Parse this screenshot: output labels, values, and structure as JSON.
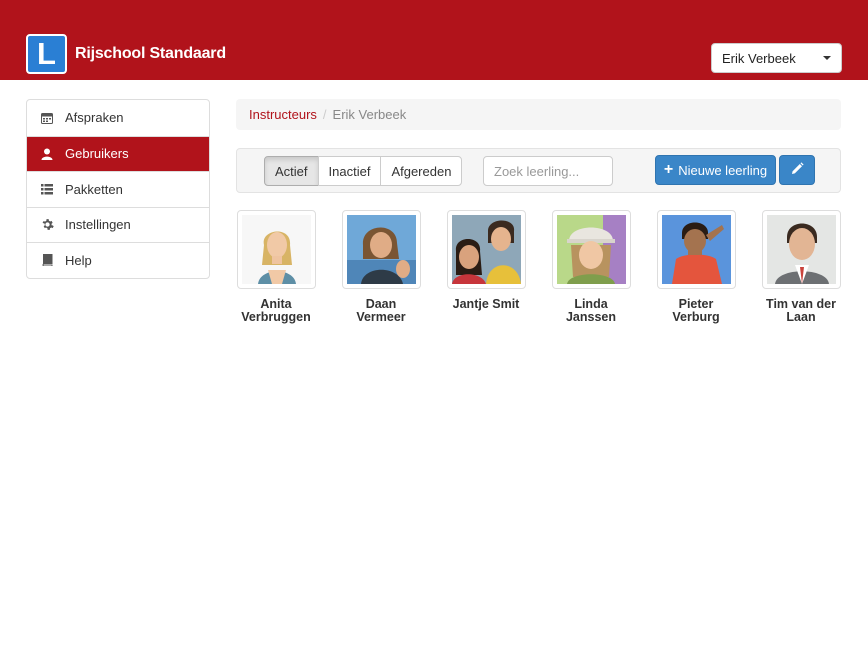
{
  "header": {
    "logo_letter": "L",
    "brand": "Rijschool Standaard",
    "user": "Erik Verbeek"
  },
  "sidebar": {
    "items": [
      {
        "label": "Afspraken",
        "icon": "calendar-icon"
      },
      {
        "label": "Gebruikers",
        "icon": "user-icon",
        "active": true
      },
      {
        "label": "Pakketten",
        "icon": "list-icon"
      },
      {
        "label": "Instellingen",
        "icon": "gear-icon"
      },
      {
        "label": "Help",
        "icon": "book-icon"
      }
    ]
  },
  "breadcrumb": {
    "link": "Instructeurs",
    "separator": "/",
    "current": "Erik Verbeek"
  },
  "toolbar": {
    "filters": [
      "Actief",
      "Inactief",
      "Afgereden"
    ],
    "active_filter": "Actief",
    "search_placeholder": "Zoek leerling...",
    "new_button": "Nieuwe leerling"
  },
  "students": [
    {
      "name": "Anita Verbruggen"
    },
    {
      "name": "Daan Vermeer"
    },
    {
      "name": "Jantje Smit"
    },
    {
      "name": "Linda Janssen"
    },
    {
      "name": "Pieter Verburg"
    },
    {
      "name": "Tim van der Laan"
    }
  ],
  "colors": {
    "brand_red": "#b1131b",
    "primary_blue": "#3a86c8",
    "logo_blue": "#2a7fd4"
  }
}
